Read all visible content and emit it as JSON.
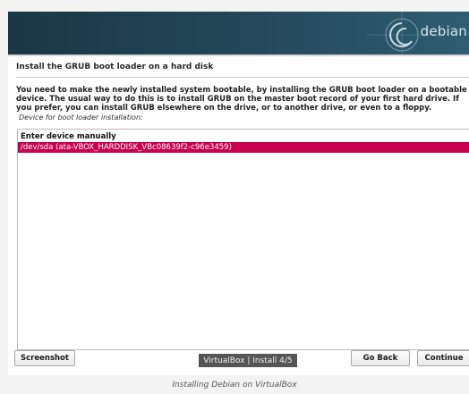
{
  "banner": {
    "brand": "debian",
    "logo_icon": "debian-swirl-icon"
  },
  "step_title": "Install the GRUB boot loader on a hard disk",
  "description": "You need to make the newly installed system bootable, by installing the GRUB boot loader on a bootable device. The usual way to do this is to install GRUB on the master boot record of your first hard drive. If you prefer, you can install GRUB elsewhere on the drive, or to another drive, or even to a floppy.",
  "field_label": "Device for boot loader installation:",
  "device_list": {
    "options": [
      "Enter device manually",
      "/dev/sda  (ata-VBOX_HARDDISK_VBc08639f2-c96e3459)"
    ],
    "selected_index": 1
  },
  "buttons": {
    "screenshot": "Screenshot",
    "go_back": "Go Back",
    "continue": "Continue"
  },
  "overlay_tag": "VirtualBox | Install 4/5",
  "caption": "Installing Debian on VirtualBox",
  "colors": {
    "banner": "#24495a",
    "selection": "#c8004f"
  }
}
